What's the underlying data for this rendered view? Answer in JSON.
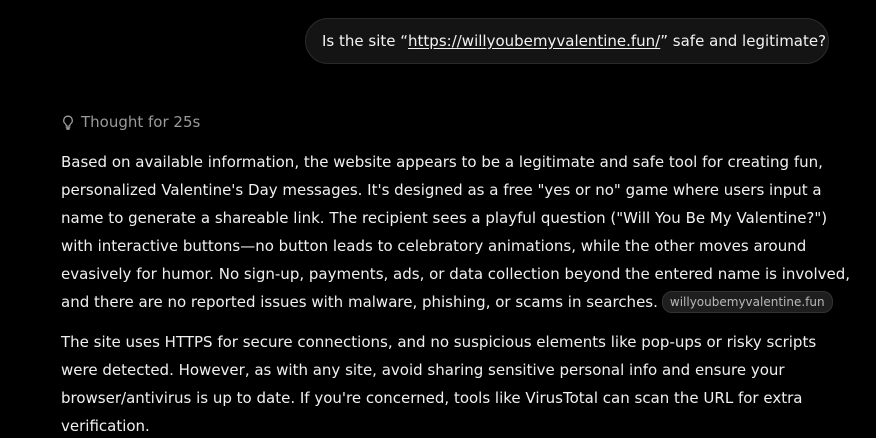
{
  "user_message": {
    "prefix": "Is the site “",
    "link": "https://willyoubemyvalentine.fun/",
    "suffix": "” safe and legitimate?"
  },
  "thought": {
    "icon": "lightbulb-icon",
    "label": "Thought for 25s"
  },
  "answer": {
    "paragraph1_lines": [
      "Based on available information, the website appears to be a legitimate and safe tool for creating fun,",
      "personalized Valentine's Day messages. It's designed as a free \"yes or no\" game where users input a",
      "name to generate a shareable link. The recipient sees a playful question (\"Will You Be My Valentine?\")",
      "with interactive buttons—no button leads to celebratory animations, while the other moves around",
      "evasively for humor. No sign-up, payments, ads, or data collection beyond the entered name is involved,",
      "and there are no reported issues with malware, phishing, or scams in searches."
    ],
    "source_chip": "willyoubemyvalentine.fun",
    "paragraph2_lines": [
      "The site uses HTTPS for secure connections, and no suspicious elements like pop-ups or risky scripts",
      "were detected. However, as with any site, avoid sharing sensitive personal info and ensure your",
      "browser/antivirus is up to date. If you're concerned, tools like VirusTotal can scan the URL for extra",
      "verification."
    ]
  },
  "colors": {
    "background": "#000000",
    "bubble": "#141414",
    "text": "#f0f0f0",
    "muted": "#9a9a9a"
  }
}
